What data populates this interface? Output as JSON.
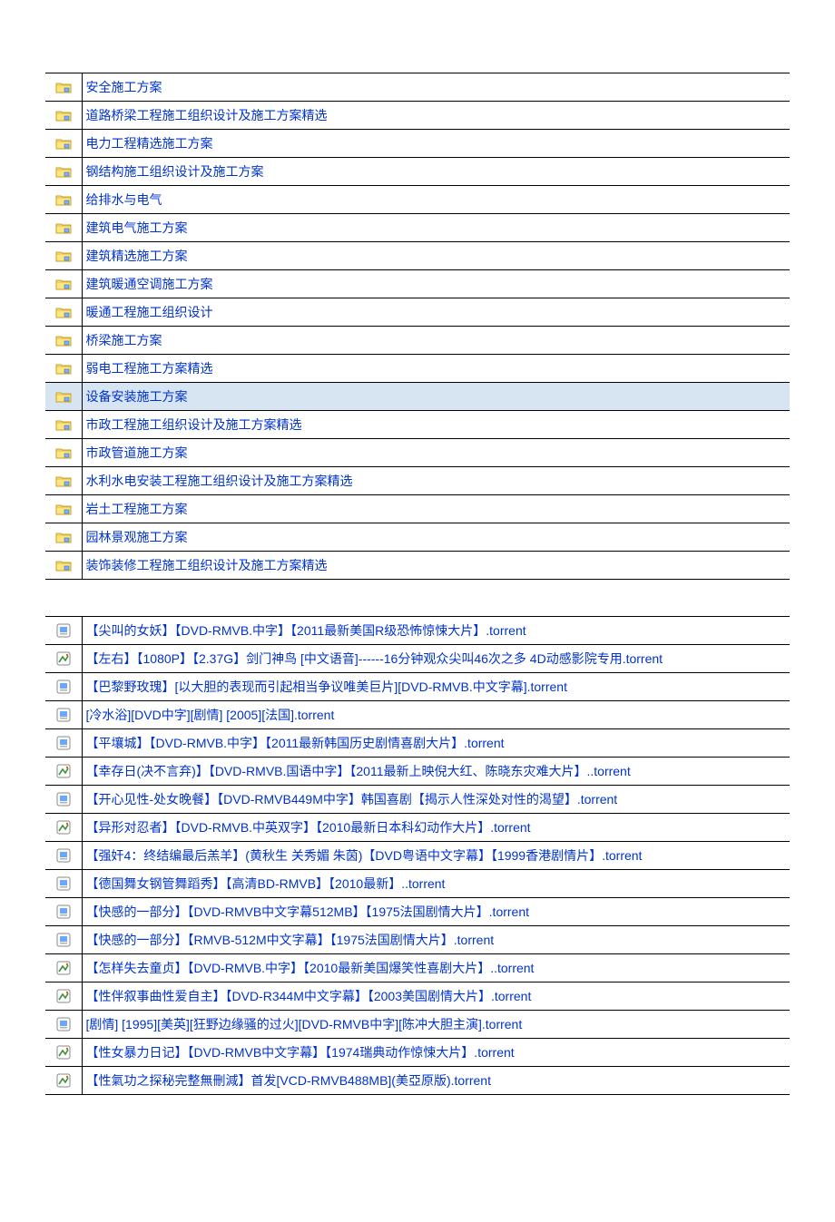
{
  "folders": [
    "安全施工方案",
    "道路桥梁工程施工组织设计及施工方案精选",
    "电力工程精选施工方案",
    "钢结构施工组织设计及施工方案",
    "给排水与电气",
    "建筑电气施工方案",
    "建筑精选施工方案",
    "建筑暖通空调施工方案",
    "暖通工程施工组织设计",
    "桥梁施工方案",
    "弱电工程施工方案精选",
    "设备安装施工方案",
    "市政工程施工组织设计及施工方案精选",
    "市政管道施工方案",
    "水利水电安装工程施工组织设计及施工方案精选",
    "岩土工程施工方案",
    "园林景观施工方案",
    "装饰装修工程施工组织设计及施工方案精选"
  ],
  "selectedFolderIndex": 11,
  "files": [
    {
      "icon": "bt",
      "name": "【尖叫的女妖】【DVD-RMVB.中字】【2011最新美国R级恐怖惊悚大片】.torrent"
    },
    {
      "icon": "bt2",
      "name": "【左右】【1080P】【2.37G】剑门神鸟  [中文语音]------16分钟观众尖叫46次之多   4D动感影院专用.torrent"
    },
    {
      "icon": "bt",
      "name": "【巴黎野玫瑰】[以大胆的表现而引起相当争议唯美巨片][DVD-RMVB.中文字幕].torrent"
    },
    {
      "icon": "bt",
      "name": "[冷水浴][DVD中字][剧情] [2005][法国].torrent"
    },
    {
      "icon": "bt",
      "name": "【平壤城】【DVD-RMVB.中字】【2011最新韩国历史剧情喜剧大片】.torrent"
    },
    {
      "icon": "bt2",
      "name": "【幸存日(决不言弃)】【DVD-RMVB.国语中字】【2011最新上映倪大红、陈晓东灾难大片】..torrent"
    },
    {
      "icon": "bt",
      "name": "【开心见性-处女晚餐】【DVD-RMVB449M中字】韩国喜剧【揭示人性深处对性的渴望】.torrent"
    },
    {
      "icon": "bt2",
      "name": "【异形对忍者】【DVD-RMVB.中英双字】【2010最新日本科幻动作大片】.torrent"
    },
    {
      "icon": "bt",
      "name": "【强奸4：终结编最后羔羊】(黄秋生  关秀媚  朱茵)【DVD粤语中文字幕】【1999香港剧情片】.torrent"
    },
    {
      "icon": "bt",
      "name": "【德国舞女钢管舞蹈秀】【高清BD-RMVB】【2010最新】..torrent"
    },
    {
      "icon": "bt",
      "name": "【快感的一部分】【DVD-RMVB中文字幕512MB】【1975法国剧情大片】.torrent"
    },
    {
      "icon": "bt",
      "name": "【快感的一部分】【RMVB-512M中文字幕】【1975法国剧情大片】.torrent"
    },
    {
      "icon": "bt2",
      "name": "【怎样失去童贞】【DVD-RMVB.中字】【2010最新美国爆笑性喜剧大片】..torrent"
    },
    {
      "icon": "bt2",
      "name": "【性伴叙事曲性爱自主】【DVD-R344M中文字幕】【2003美国剧情大片】.torrent"
    },
    {
      "icon": "bt",
      "name": "[剧情] [1995][美英][狂野边缘骚的过火][DVD-RMVB中字][陈冲大胆主演].torrent"
    },
    {
      "icon": "bt2",
      "name": "【性女暴力日记】【DVD-RMVB中文字幕】【1974瑞典动作惊悚大片】.torrent"
    },
    {
      "icon": "bt2",
      "name": "【性氣功之探秘完整無刪減】首发[VCD-RMVB488MB](美亞原版).torrent"
    }
  ]
}
